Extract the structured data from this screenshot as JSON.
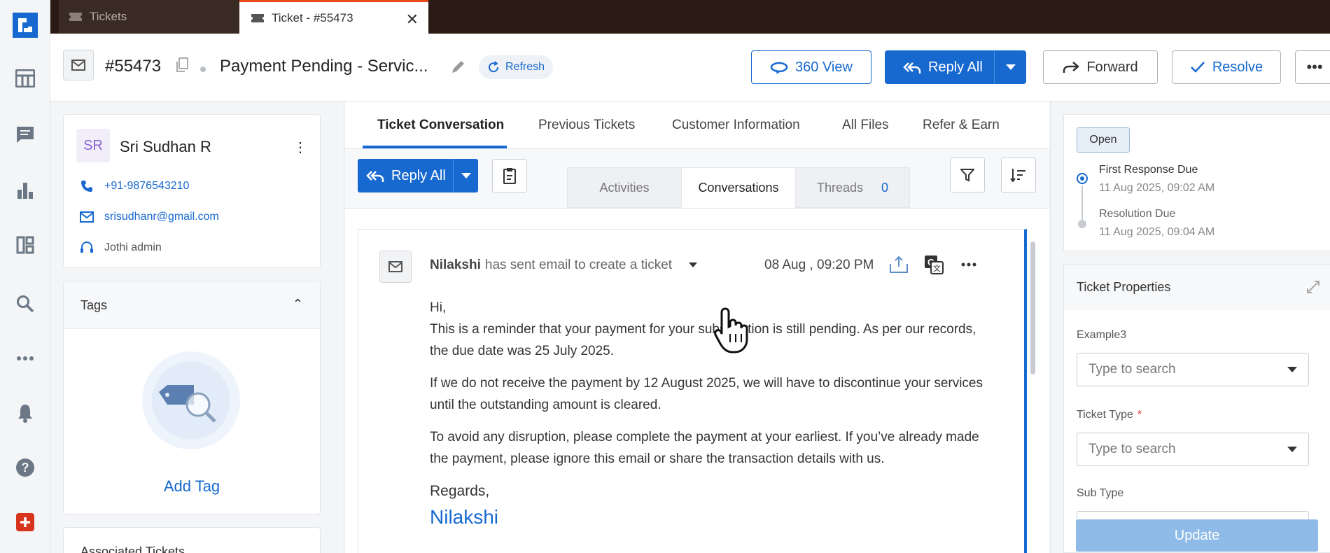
{
  "browser_tabs": [
    {
      "label": "Tickets",
      "active": false
    },
    {
      "label": "Ticket - #55473",
      "active": true
    }
  ],
  "header": {
    "ticket_id": "#55473",
    "subject": "Payment Pending - Servic...",
    "refresh_label": "Refresh",
    "view360_label": "360 View",
    "reply_all_label": "Reply All",
    "forward_label": "Forward",
    "resolve_label": "Resolve",
    "more_label": "•••"
  },
  "contact": {
    "initials": "SR",
    "name": "Sri Sudhan R",
    "phone": "+91-9876543210",
    "email": "srisudhanr@gmail.com",
    "agent": "Jothi admin"
  },
  "tags": {
    "title": "Tags",
    "add_label": "Add Tag"
  },
  "associated": {
    "title": "Associated Tickets"
  },
  "main_tabs": [
    "Ticket Conversation",
    "Previous Tickets",
    "Customer Information",
    "All Files",
    "Refer & Earn"
  ],
  "toolbar": {
    "reply_all_label": "Reply All",
    "segments": {
      "activities": "Activities",
      "conversations": "Conversations",
      "threads": "Threads",
      "threads_count": "0"
    }
  },
  "email": {
    "sender": "Nilakshi",
    "action_text": "has sent email to create a ticket",
    "datetime": "08 Aug , 09:20 PM",
    "greeting": "Hi,",
    "para1": "This is a reminder that your payment for your subscription is still pending. As per our records, the due date was 25 July 2025.",
    "para2": "If we do not receive the payment by 12 August 2025, we will have to discontinue your services until the outstanding amount is cleared.",
    "para3": "To avoid any disruption, please complete the payment at your earliest. If you’ve already made the payment, please ignore this email or share the transaction details with us.",
    "regards": "Regards,",
    "signature": "Nilakshi"
  },
  "sla": {
    "status": "Open",
    "first_response_label": "First Response Due",
    "first_response_time": "11 Aug 2025, 09:02 AM",
    "resolution_label": "Resolution Due",
    "resolution_time": "11 Aug 2025, 09:04 AM"
  },
  "properties": {
    "title": "Ticket Properties",
    "field1_label": "Example3",
    "field1_placeholder": "Type to search",
    "field2_label": "Ticket Type",
    "field2_required": "*",
    "field2_placeholder": "Type to search",
    "field3_label": "Sub Type",
    "update_label": "Update"
  },
  "colors": {
    "primary": "#1769d0",
    "tabbar": "#2c1a14",
    "accent_tab": "#e84a1c",
    "required": "#e0322d"
  }
}
